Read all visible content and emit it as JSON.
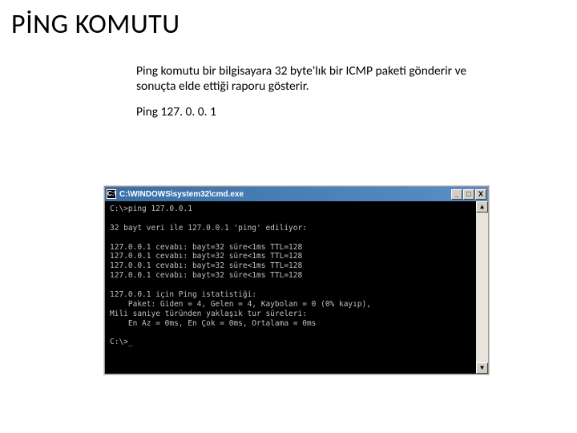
{
  "slide": {
    "title": "PİNG KOMUTU",
    "description": "Ping komutu bir bilgisayara 32 byte'lık bir ICMP paketi gönderir ve sonuçta elde ettiği raporu gösterir.",
    "example_cmd": "Ping 127. 0. 0. 1"
  },
  "cmd_window": {
    "sysicon_glyph": "C:\\",
    "title": "C:\\WINDOWS\\system32\\cmd.exe",
    "buttons": {
      "min": "_",
      "max": "□",
      "close": "X"
    },
    "scroll": {
      "up": "▲",
      "down": "▼"
    },
    "terminal_text": "C:\\>ping 127.0.0.1\n\n32 bayt veri ile 127.0.0.1 'ping' ediliyor:\n\n127.0.0.1 cevabı: bayt=32 süre<1ms TTL=128\n127.0.0.1 cevabı: bayt=32 süre<1ms TTL=128\n127.0.0.1 cevabı: bayt=32 süre<1ms TTL=128\n127.0.0.1 cevabı: bayt=32 süre<1ms TTL=128\n\n127.0.0.1 için Ping istatistiği:\n    Paket: Giden = 4, Gelen = 4, Kaybolan = 0 (0% kayıp),\nMili saniye türünden yaklaşık tur süreleri:\n    En Az = 0ms, En Çok = 0ms, Ortalama = 0ms\n\nC:\\>_"
  }
}
